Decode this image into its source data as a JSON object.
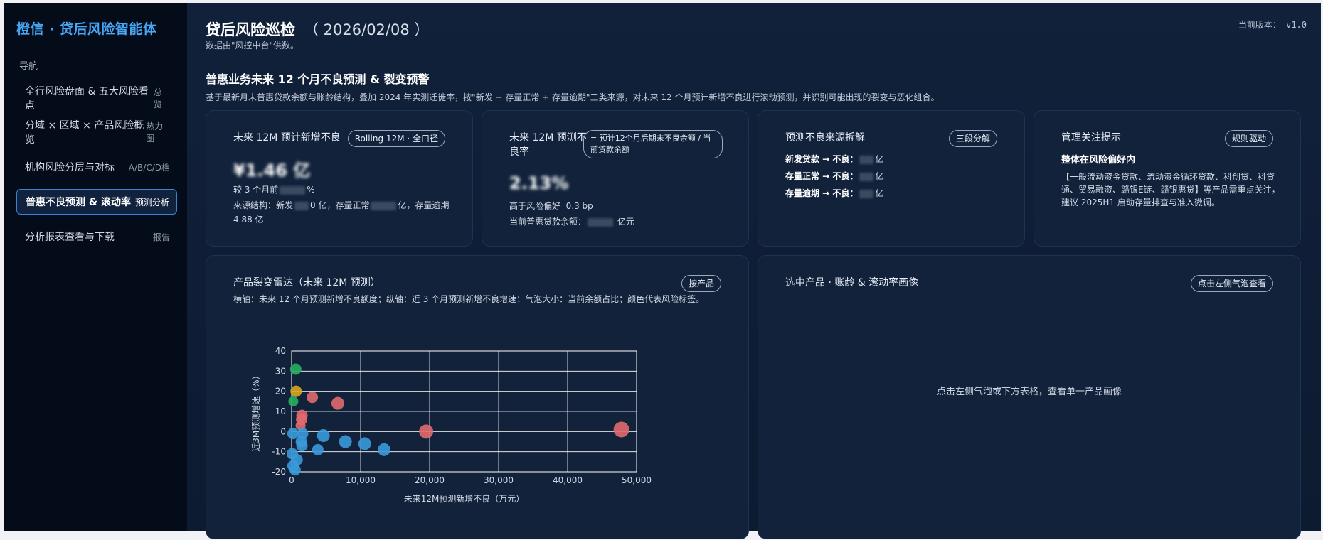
{
  "sidebar": {
    "brand": "橙信 · 贷后风险智能体",
    "nav_heading": "导航",
    "items": [
      {
        "label": "全行风险盘面 & 五大风险看点",
        "tag": "总览"
      },
      {
        "label": "分域 × 区域 × 产品风险概览",
        "tag": "热力图"
      },
      {
        "label": "机构风险分层与对标",
        "tag": "A/B/C/D档"
      },
      {
        "label": "普惠不良预测 & 滚动率",
        "tag": "预测分析"
      },
      {
        "label": "分析报表查看与下载",
        "tag": "报告"
      }
    ]
  },
  "header": {
    "title": "贷后风险巡检",
    "date": "（ 2026/02/08 ）",
    "subtitle": "数据由\"风控中台\"供数。",
    "version": "当前版本： v1.0"
  },
  "section": {
    "title": "普惠业务未来 12 个月不良预测 & 裂变预警",
    "desc": "基于最新月末普惠贷款余额与账龄结构，叠加 2024 年实测迁徙率，按\"新发 + 存量正常 + 存量逾期\"三类来源，对未来 12 个月预计新增不良进行滚动预测，并识别可能出现的裂变与恶化组合。"
  },
  "cards": {
    "c1": {
      "title": "未来 12M 预计新增不良",
      "pill": "Rolling 12M · 全口径",
      "value": "¥1.46 亿",
      "change_prefix": "较 3 个月前",
      "change_suffix": "%",
      "src_a": "来源结构：新发",
      "src_b": "0 亿，存量正常",
      "src_c": "亿，存量逾期",
      "src_d": "4.88 亿"
    },
    "c2": {
      "title": "未来 12M 预测不良率",
      "pill": "= 预计12个月后期末不良余额 / 当前贷款余额",
      "value": "2.13%",
      "status": "高于风险偏好",
      "delta": "0.3 bp",
      "balance_prefix": "当前普惠贷款余额：",
      "balance_suffix": "亿元"
    },
    "c3": {
      "title": "预测不良来源拆解",
      "pill": "三段分解",
      "rows": [
        {
          "label": "新发贷款 → 不良：",
          "unit": "亿"
        },
        {
          "label": "存量正常 → 不良：",
          "unit": "亿"
        },
        {
          "label": "存量逾期 → 不良：",
          "unit": "亿"
        }
      ]
    },
    "c4": {
      "title": "管理关注提示",
      "pill": "规则驱动",
      "headline": "整体在风险偏好内",
      "body": "【一般流动资金贷款、流动资金循环贷款、科创贷、科贷通、贸易融资、赣银E链、赣银惠贷】等产品需重点关注，建议 2025H1 启动存量排查与准入微调。"
    },
    "c5": {
      "title": "产品裂变雷达（未来 12M 预测）",
      "pill": "按产品",
      "desc": "横轴：未来 12 个月预测新增不良额度；纵轴：近 3 个月预测新增不良增速；气泡大小：当前余额占比；颜色代表风险标签。"
    },
    "c6": {
      "title": "选中产品 · 账龄 & 滚动率画像",
      "pill": "点击左侧气泡查看",
      "hint": "点击左侧气泡或下方表格，查看单一产品画像"
    }
  },
  "colors": {
    "blue": "#3a9ad9",
    "red": "#e06a6f",
    "green": "#27ae60",
    "yellow": "#d9a521"
  },
  "chart_data": {
    "type": "scatter",
    "title": "",
    "xlabel": "未来12M预测新增不良（万元）",
    "ylabel": "近3M预测增速（%）",
    "xlim": [
      0,
      50000
    ],
    "ylim": [
      -20,
      40
    ],
    "x_ticks": [
      "0",
      "10,000",
      "20,000",
      "30,000",
      "40,000",
      "50,000"
    ],
    "y_ticks": [
      "-20",
      "-10",
      "0",
      "10",
      "20",
      "30",
      "40"
    ],
    "grid": true,
    "points": [
      {
        "x": 600,
        "y": 31,
        "r": 8,
        "color": "green"
      },
      {
        "x": 650,
        "y": 20,
        "r": 8,
        "color": "yellow"
      },
      {
        "x": 250,
        "y": 15,
        "r": 7,
        "color": "green"
      },
      {
        "x": 3000,
        "y": 17,
        "r": 8,
        "color": "red"
      },
      {
        "x": 6700,
        "y": 14,
        "r": 9,
        "color": "red"
      },
      {
        "x": 1500,
        "y": 8,
        "r": 8,
        "color": "red"
      },
      {
        "x": 1450,
        "y": 6,
        "r": 8,
        "color": "red"
      },
      {
        "x": 1300,
        "y": 3,
        "r": 7,
        "color": "red"
      },
      {
        "x": 19500,
        "y": 0,
        "r": 10,
        "color": "red"
      },
      {
        "x": 47800,
        "y": 1,
        "r": 11,
        "color": "red"
      },
      {
        "x": 200,
        "y": -1,
        "r": 8,
        "color": "blue"
      },
      {
        "x": 1600,
        "y": -1,
        "r": 8,
        "color": "blue"
      },
      {
        "x": 4600,
        "y": -2,
        "r": 9,
        "color": "blue"
      },
      {
        "x": 7800,
        "y": -5,
        "r": 9,
        "color": "blue"
      },
      {
        "x": 10600,
        "y": -6,
        "r": 9,
        "color": "blue"
      },
      {
        "x": 13400,
        "y": -9,
        "r": 9,
        "color": "blue"
      },
      {
        "x": 3800,
        "y": -9,
        "r": 8,
        "color": "blue"
      },
      {
        "x": 1500,
        "y": -7,
        "r": 8,
        "color": "blue"
      },
      {
        "x": 1400,
        "y": -5,
        "r": 8,
        "color": "blue"
      },
      {
        "x": 100,
        "y": -11,
        "r": 8,
        "color": "blue"
      },
      {
        "x": 800,
        "y": -14,
        "r": 8,
        "color": "blue"
      },
      {
        "x": 200,
        "y": -17,
        "r": 8,
        "color": "blue"
      },
      {
        "x": 500,
        "y": -19,
        "r": 8,
        "color": "blue"
      }
    ]
  }
}
